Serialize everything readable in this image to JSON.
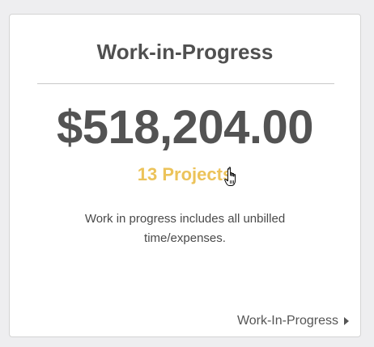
{
  "card": {
    "title": "Work-in-Progress",
    "amount": "$518,204.00",
    "projects_link": "13 Projects",
    "description": "Work in progress includes all unbilled time/expenses.",
    "footer_link": "Work-In-Progress"
  },
  "icons": {
    "cursor": "hand-pointer-icon",
    "caret": "caret-right-icon"
  },
  "colors": {
    "accent": "#ecc35a",
    "text": "#535353",
    "background": "#eeeef0"
  }
}
